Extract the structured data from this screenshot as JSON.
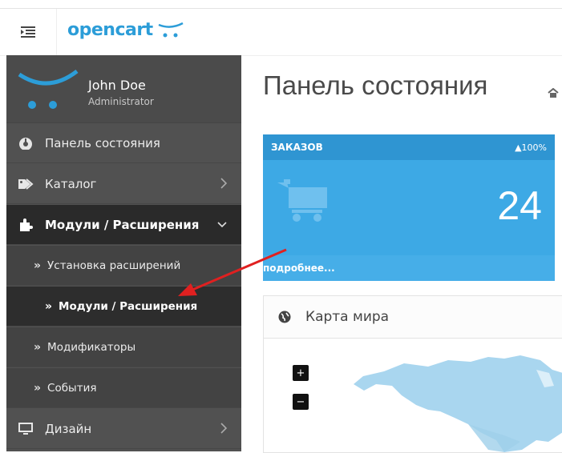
{
  "brand": {
    "logo_text": "opencart"
  },
  "user": {
    "name": "John Doe",
    "role": "Administrator"
  },
  "sidebar": {
    "items": [
      {
        "label": "Панель состояния"
      },
      {
        "label": "Каталог"
      },
      {
        "label": "Модули / Расширения"
      },
      {
        "label": "Установка расширений"
      },
      {
        "label": "Модули / Расширения"
      },
      {
        "label": "Модификаторы"
      },
      {
        "label": "События"
      },
      {
        "label": "Дизайн"
      }
    ]
  },
  "main": {
    "title": "Панель состояния",
    "orders_tile": {
      "title": "ЗАКАЗОВ",
      "change": "▲100%",
      "count": "24",
      "more": "подробнее..."
    },
    "map_panel": {
      "title": "Карта мира",
      "zoom_in": "+",
      "zoom_out": "−"
    }
  },
  "colors": {
    "brand": "#2c9dd8",
    "sidebar": "#515151",
    "tile": "#3da9e5",
    "arrow": "#e02020",
    "map_land": "#a9d6ef"
  }
}
